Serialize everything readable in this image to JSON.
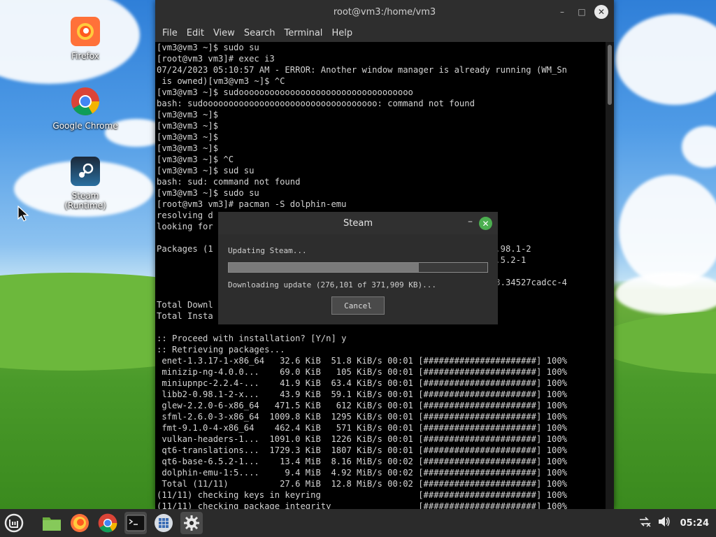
{
  "desktop": {
    "icons": [
      {
        "label": "Firefox",
        "icon": "firefox-icon"
      },
      {
        "label": "Google Chrome",
        "icon": "chrome-icon"
      },
      {
        "label": "Steam (Runtime)",
        "icon": "steam-icon"
      }
    ]
  },
  "terminal": {
    "title": "root@vm3:/home/vm3",
    "menu": [
      "File",
      "Edit",
      "View",
      "Search",
      "Terminal",
      "Help"
    ],
    "lines": [
      "[vm3@vm3 ~]$ sudo su",
      "[root@vm3 vm3]# exec i3",
      "07/24/2023 05:10:57 AM - ERROR: Another window manager is already running (WM_Sn",
      " is owned)[vm3@vm3 ~]$ ^C",
      "[vm3@vm3 ~]$ sudoooooooooooooooooooooooooooooooooo",
      "bash: sudoooooooooooooooooooooooooooooooooo: command not found",
      "[vm3@vm3 ~]$",
      "[vm3@vm3 ~]$",
      "[vm3@vm3 ~]$",
      "[vm3@vm3 ~]$",
      "[vm3@vm3 ~]$ ^C",
      "[vm3@vm3 ~]$ sud su",
      "bash: sud: command not found",
      "[vm3@vm3 ~]$ sudo su",
      "[root@vm3 vm3]# pacman -S dolphin-emu",
      "resolving d",
      "looking for",
      "",
      "Packages (1                                                     -0.98.1-2",
      "                                                                -6.5.2-1",
      "",
      "                                                              19433.34527cadcc-4",
      "",
      "Total Downl",
      "Total Insta",
      "",
      ":: Proceed with installation? [Y/n] y",
      ":: Retrieving packages...",
      " enet-1.3.17-1-x86_64   32.6 KiB  51.8 KiB/s 00:01 [######################] 100%",
      " minizip-ng-4.0.0...    69.0 KiB   105 KiB/s 00:01 [######################] 100%",
      " miniupnpc-2.2.4-...    41.9 KiB  63.4 KiB/s 00:01 [######################] 100%",
      " libb2-0.98.1-2-x...    43.9 KiB  59.1 KiB/s 00:01 [######################] 100%",
      " glew-2.2.0-6-x86_64   471.5 KiB   612 KiB/s 00:01 [######################] 100%",
      " sfml-2.6.0-3-x86_64  1009.8 KiB  1295 KiB/s 00:01 [######################] 100%",
      " fmt-9.1.0-4-x86_64    462.4 KiB   571 KiB/s 00:01 [######################] 100%",
      " vulkan-headers-1...  1091.0 KiB  1226 KiB/s 00:01 [######################] 100%",
      " qt6-translations...  1729.3 KiB  1807 KiB/s 00:01 [######################] 100%",
      " qt6-base-6.5.2-1...    13.4 MiB  8.16 MiB/s 00:02 [######################] 100%",
      " dolphin-emu-1:5....     9.4 MiB  4.92 MiB/s 00:02 [######################] 100%",
      " Total (11/11)          27.6 MiB  12.8 MiB/s 00:02 [######################] 100%",
      "(11/11) checking keys in keyring                   [######################] 100%",
      "(11/11) checking package integrity                 [######################] 100%"
    ]
  },
  "steam_dialog": {
    "title": "Steam",
    "status": "Updating Steam...",
    "progress": 0.735,
    "detail": "Downloading update (276,101 of 371,909 KB)...",
    "cancel_label": "Cancel",
    "close_color": "#4caf50"
  },
  "taskbar": {
    "items": [
      "mint-menu-icon",
      "files-icon",
      "firefox-icon",
      "chrome-icon",
      "terminal-icon",
      "apps-icon",
      "settings-icon"
    ],
    "clock": "05:24"
  }
}
